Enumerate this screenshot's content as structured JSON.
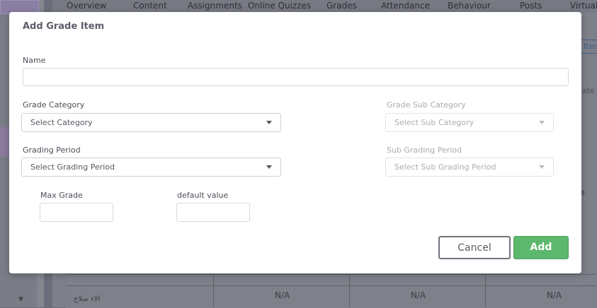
{
  "background": {
    "tabs": [
      "Overview",
      "Content",
      "Assignments",
      "Online Quizzes",
      "Grades",
      "Attendance",
      "Behaviour",
      "Posts",
      "Virtual"
    ],
    "side_link": "Item",
    "side_text": "ate",
    "side_e": "e",
    "row_name": "الاء صلاح",
    "cells": [
      "N/A",
      "N/A",
      "N/A"
    ]
  },
  "modal": {
    "title": "Add Grade Item",
    "name_label": "Name",
    "name_value": "",
    "grade_category_label": "Grade Category",
    "grade_category_value": "Select Category",
    "grade_sub_category_label": "Grade Sub Category",
    "grade_sub_category_value": "Select Sub Category",
    "grading_period_label": "Grading Period",
    "grading_period_value": "Select Grading Period",
    "sub_grading_period_label": "Sub Grading Period",
    "sub_grading_period_value": "Select Sub Grading Period",
    "max_grade_label": "Max Grade",
    "max_grade_value": "",
    "default_value_label": "default value",
    "default_value_value": "",
    "cancel_label": "Cancel",
    "add_label": "Add"
  },
  "colors": {
    "add_button": "#5cb86c",
    "overlay": "#6b6e7a"
  }
}
